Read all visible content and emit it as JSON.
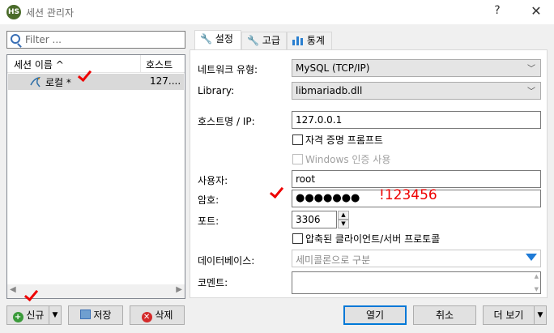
{
  "window": {
    "title": "세션 관리자",
    "help": "?",
    "close": "✕",
    "app_icon_text": "HS"
  },
  "left": {
    "filter_placeholder": "Filter ...",
    "col_name": "세션 이름 ^",
    "col_host": "호스트",
    "session": {
      "name": "로컬 *",
      "host": "127...."
    },
    "scroll_left": "◀",
    "scroll_right": "▶"
  },
  "bottom_left": {
    "new": "신규",
    "save": "저장",
    "delete": "삭제"
  },
  "bottom_right": {
    "open": "열기",
    "cancel": "취소",
    "more": "더 보기"
  },
  "tabs": {
    "settings": "설정",
    "advanced": "고급",
    "stats": "통계"
  },
  "form": {
    "network_type_label": "네트워크 유형:",
    "network_type_value": "MySQL (TCP/IP)",
    "library_label": "Library:",
    "library_value": "libmariadb.dll",
    "host_label": "호스트명 / IP:",
    "host_value": "127.0.0.1",
    "credential_prompt": "자격 증명 프롬프트",
    "windows_auth": "Windows 인증 사용",
    "user_label": "사용자:",
    "user_value": "root",
    "password_label": "암호:",
    "password_value": "●●●●●●●",
    "port_label": "포트:",
    "port_value": "3306",
    "compressed": "압축된 클라이언트/서버 프로토콜",
    "databases_label": "데이터베이스:",
    "databases_placeholder": "세미콜론으로 구분",
    "comment_label": "코멘트:"
  },
  "annotations": {
    "password_hint": "!123456"
  },
  "colors": {
    "accent": "#0078d7",
    "annotation": "#ee0000"
  }
}
